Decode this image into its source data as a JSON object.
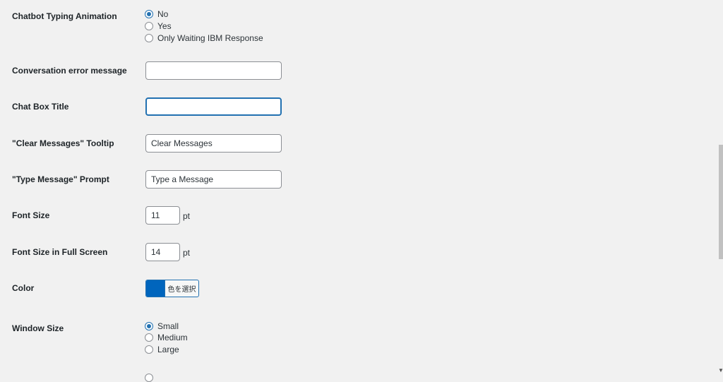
{
  "typing_animation": {
    "label": "Chatbot Typing Animation",
    "options": [
      "No",
      "Yes",
      "Only Waiting IBM Response"
    ],
    "selected": "No"
  },
  "conversation_error": {
    "label": "Conversation error message",
    "value": ""
  },
  "chat_box_title": {
    "label": "Chat Box Title",
    "value": ""
  },
  "clear_tooltip": {
    "label": "\"Clear Messages\" Tooltip",
    "value": "Clear Messages"
  },
  "type_prompt": {
    "label": "\"Type Message\" Prompt",
    "value": "Type a Message"
  },
  "font_size": {
    "label": "Font Size",
    "value": "11",
    "unit": "pt"
  },
  "font_size_full": {
    "label": "Font Size in Full Screen",
    "value": "14",
    "unit": "pt"
  },
  "color": {
    "label": "Color",
    "button_label": "色を選択",
    "swatch": "#0065bd"
  },
  "window_size": {
    "label": "Window Size",
    "options": [
      "Small",
      "Medium",
      "Large"
    ],
    "selected": "Small"
  },
  "colors": {
    "accent": "#2271b1",
    "background": "#f1f1f1"
  }
}
